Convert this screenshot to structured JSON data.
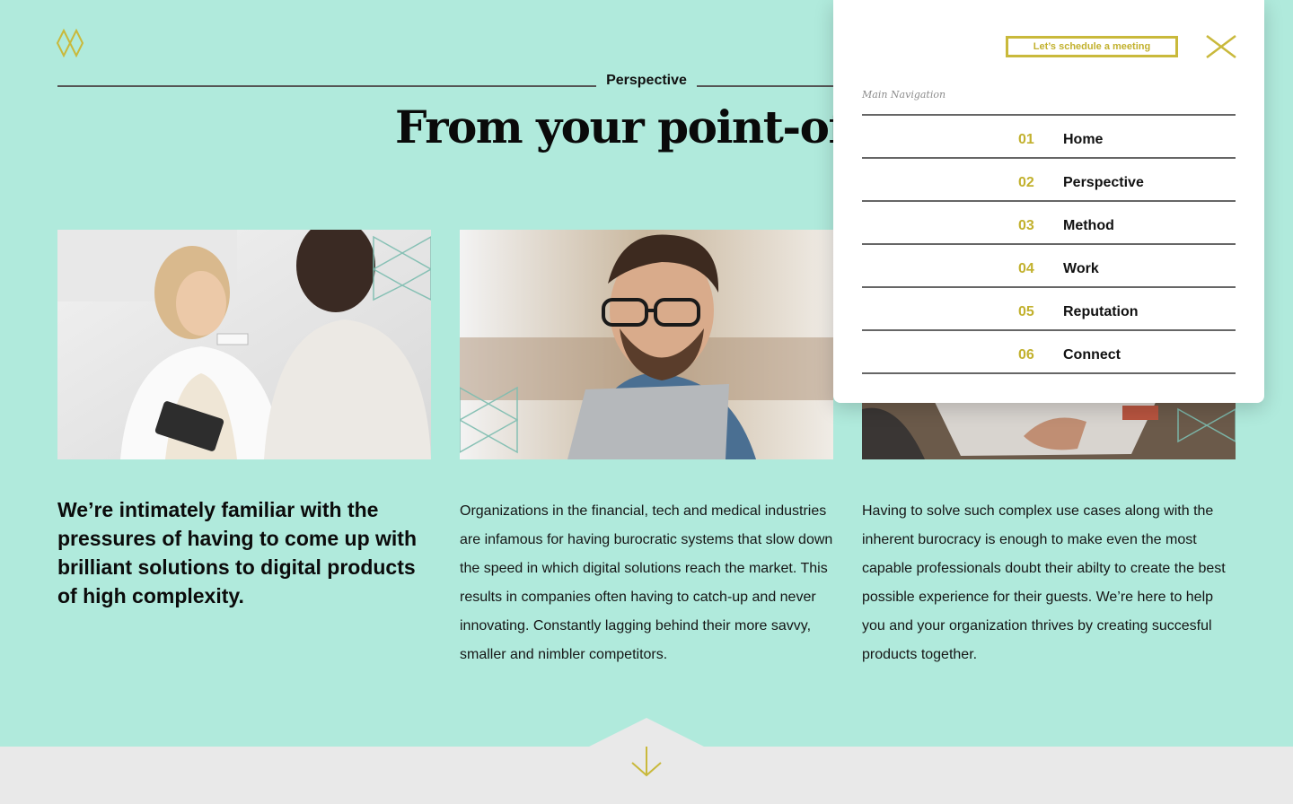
{
  "brand": {
    "logo_icon": "double-diamond-logo-icon",
    "accent_color": "#c9b93b",
    "background": "#b0eadc"
  },
  "section": {
    "label": "Perspective"
  },
  "headline": {
    "visible_text": "From your point-of-vi"
  },
  "images": [
    {
      "alt": "Doctor showing a patient results on a phone"
    },
    {
      "alt": "Smiling man with glasses working on a laptop"
    },
    {
      "alt": "Person typing on a laptop"
    }
  ],
  "columns": [
    {
      "text": "We’re intimately familiar with the pressures of having to come up with brilliant solutions to digital products of high complexity."
    },
    {
      "text": "Organizations in the financial, tech and medical industries are infamous for having burocratic systems that slow down the speed in which digital solutions reach the market. This results in companies often having to catch-up and never innovating. Constantly lagging behind their more savvy, smaller and nimbler competitors."
    },
    {
      "text": "Having to solve such complex use cases along with the inherent burocracy is enough to make even the most capable professionals doubt their abilty to create the best possible experience for their guests. We’re here to help you and your organization thrives by creating succesful products together."
    }
  ],
  "footer": {
    "scroll_icon": "arrow-down-icon"
  },
  "nav_panel": {
    "cta_label": "Let’s schedule a meeting",
    "close_icon": "close-icon",
    "caption": "Main Navigation",
    "items": [
      {
        "num": "01",
        "label": "Home"
      },
      {
        "num": "02",
        "label": "Perspective"
      },
      {
        "num": "03",
        "label": "Method"
      },
      {
        "num": "04",
        "label": "Work"
      },
      {
        "num": "05",
        "label": "Reputation"
      },
      {
        "num": "06",
        "label": "Connect"
      }
    ]
  }
}
